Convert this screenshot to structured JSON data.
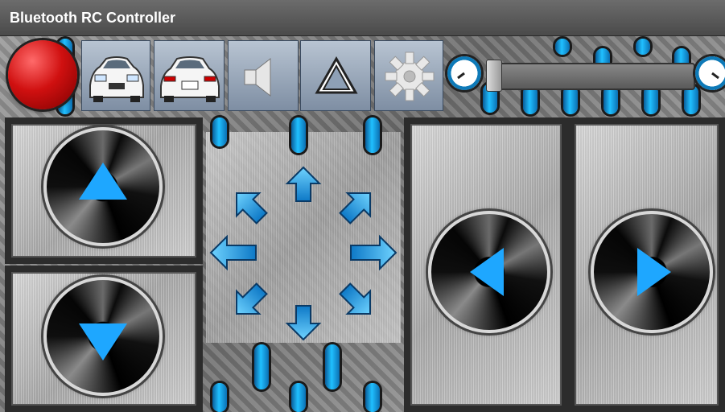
{
  "window": {
    "title": "Bluetooth RC Controller"
  },
  "toolbar": {
    "buttons": [
      {
        "icon": "record-red-icon"
      },
      {
        "icon": "car-front-icon"
      },
      {
        "icon": "car-rear-icon"
      },
      {
        "icon": "speaker-icon"
      },
      {
        "icon": "warning-triangle-icon"
      },
      {
        "icon": "gear-icon"
      }
    ],
    "speed_slider": {
      "value": 0.0
    }
  },
  "colors": {
    "accent": "#1ea7ff",
    "record": "#d01010"
  }
}
